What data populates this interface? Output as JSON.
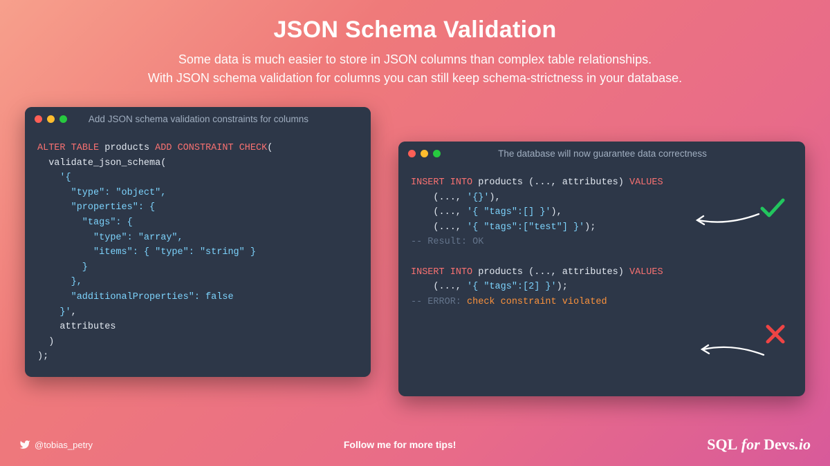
{
  "header": {
    "title": "JSON Schema Validation",
    "subtitle_line1": "Some data is much easier to store in JSON columns than complex table relationships.",
    "subtitle_line2": "With JSON schema validation for columns you can still keep schema-strictness in your database."
  },
  "panel_left": {
    "title": "Add JSON schema validation constraints for columns",
    "code": {
      "alter": "ALTER",
      "table": "TABLE",
      "products": " products ",
      "add": "ADD",
      "constraint": "CONSTRAINT",
      "check": "CHECK",
      "paren_open": "(",
      "fn": "  validate_json_schema(",
      "s1": "    '{",
      "s2": "      \"type\": \"object\",",
      "s3": "      \"properties\": {",
      "s4": "        \"tags\": {",
      "s5": "          \"type\": \"array\",",
      "s6": "          \"items\": { \"type\": \"string\" }",
      "s7": "        }",
      "s8": "      },",
      "s9": "      \"additionalProperties\": false",
      "s10": "    }'",
      "comma": ",",
      "attr": "    attributes",
      "close1": "  )",
      "close2": ");"
    }
  },
  "panel_right": {
    "title": "The database will now guarantee data correctness",
    "code": {
      "insert": "INSERT",
      "into": "INTO",
      "products_args": " products (..., attributes) ",
      "values": "VALUES",
      "row1a": "    (..., ",
      "row1b": "'{}'",
      "row1c": "),",
      "row2a": "    (..., ",
      "row2b": "'{ \"tags\":[] }'",
      "row2c": "),",
      "row3a": "    (..., ",
      "row3b": "'{ \"tags\":[\"test\"] }'",
      "row3c": ");",
      "result_ok": "-- Result: OK",
      "row4a": "    (..., ",
      "row4b": "'{ \"tags\":[2] }'",
      "row4c": ");",
      "error_pre": "-- ERROR: ",
      "error_msg": "check constraint violated"
    }
  },
  "footer": {
    "handle": "@tobias_petry",
    "follow": "Follow me for more tips!",
    "brand_prefix": "SQL",
    "brand_mid": " for ",
    "brand_suffix": "Devs",
    "brand_tld": ".io"
  }
}
